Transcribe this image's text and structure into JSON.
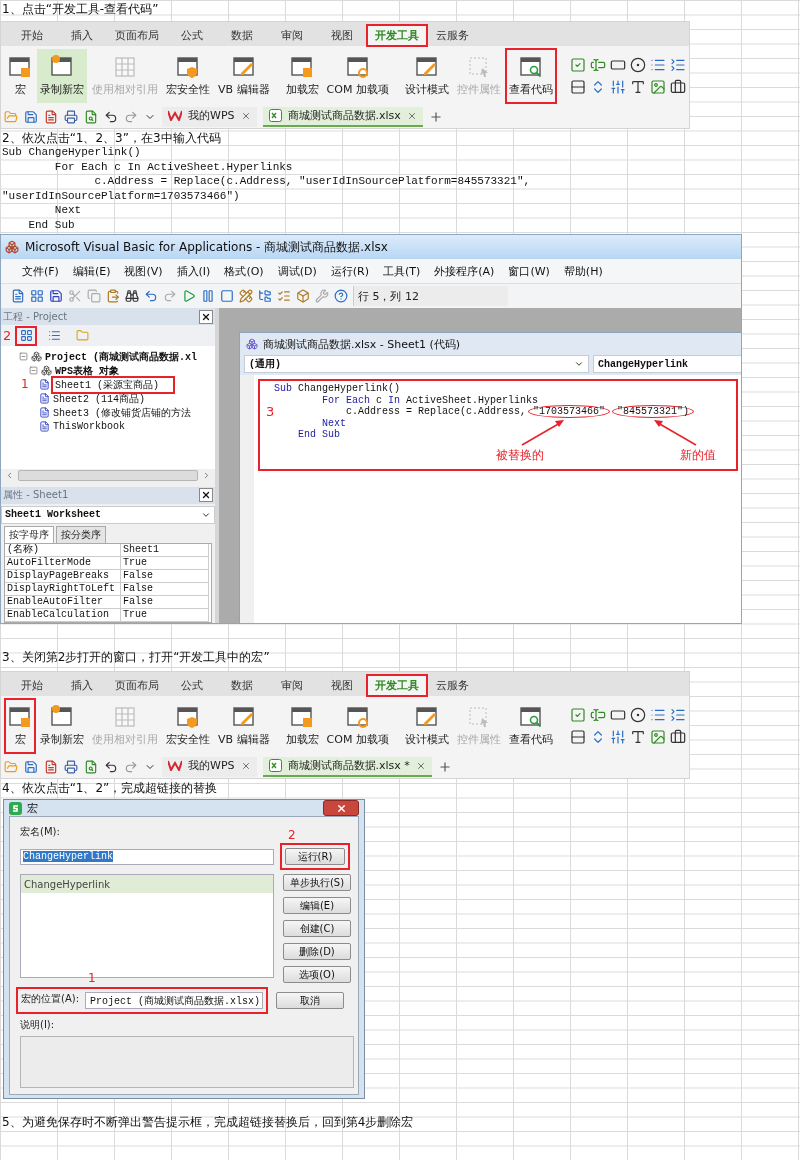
{
  "sections": [
    {
      "kind": "instruction",
      "text": "1、点击“开发工具-查看代码”"
    },
    {
      "kind": "ribbon",
      "tabs": [
        {
          "label": "开始",
          "selected": false,
          "highlighted": false
        },
        {
          "label": "插入",
          "selected": false,
          "highlighted": false
        },
        {
          "label": "页面布局",
          "selected": false,
          "highlighted": false
        },
        {
          "label": "公式",
          "selected": false,
          "highlighted": false
        },
        {
          "label": "数据",
          "selected": false,
          "highlighted": false
        },
        {
          "label": "审阅",
          "selected": false,
          "highlighted": false
        },
        {
          "label": "视图",
          "selected": false,
          "highlighted": false
        },
        {
          "label": "开发工具",
          "selected": true,
          "highlighted": true
        },
        {
          "label": "云服务",
          "selected": false,
          "highlighted": false
        }
      ],
      "tool_groups": [
        [
          {
            "label": "宏",
            "disabled": false,
            "hovered": false,
            "highlighted": false
          },
          {
            "label": "录制新宏",
            "disabled": false,
            "hovered": true,
            "highlighted": false
          },
          {
            "label": "使用相对引用",
            "disabled": true,
            "hovered": false,
            "highlighted": false
          },
          {
            "label": "宏安全性",
            "disabled": false,
            "hovered": false,
            "highlighted": false
          },
          {
            "label": "VB 编辑器",
            "disabled": false,
            "hovered": false,
            "highlighted": false
          }
        ],
        [
          {
            "label": "加载宏",
            "disabled": false,
            "hovered": false,
            "highlighted": false
          },
          {
            "label": "COM 加载项",
            "disabled": false,
            "hovered": false,
            "highlighted": false
          }
        ],
        [
          {
            "label": "设计模式",
            "disabled": false,
            "hovered": false,
            "highlighted": false
          },
          {
            "label": "控件属性",
            "disabled": true,
            "hovered": false,
            "highlighted": false
          },
          {
            "label": "查看代码",
            "disabled": false,
            "hovered": false,
            "highlighted": true
          }
        ]
      ],
      "file_tabs": [
        {
          "label": "我的WPS",
          "selected": false
        },
        {
          "label": "商城测试商品数据.xlsx",
          "selected": true
        }
      ]
    },
    {
      "kind": "instruction",
      "text": "2、依次点击“1、2、3”，在3中输入代码"
    },
    {
      "kind": "code",
      "lines": [
        "Sub ChangeHyperlink()",
        "        For Each c In ActiveSheet.Hyperlinks",
        "              c.Address = Replace(c.Address, \"userIdInSourcePlatform=845573321\",",
        "\"userIdInSourcePlatform=1703573466\")",
        "        Next",
        "    End Sub"
      ]
    },
    {
      "kind": "vba",
      "title": "Microsoft Visual Basic for Applications - 商城测试商品数据.xlsx",
      "menu": [
        "文件(F)",
        "编辑(E)",
        "视图(V)",
        "插入(I)",
        "格式(O)",
        "调试(D)",
        "运行(R)",
        "工具(T)",
        "外接程序(A)",
        "窗口(W)",
        "帮助(H)"
      ],
      "position": "行 5，列 12",
      "project": {
        "title": "工程 - Project",
        "toolbar": [
          {
            "highlighted": true,
            "marker": "2"
          },
          {
            "highlighted": false
          },
          {
            "highlighted": false
          }
        ],
        "tree": [
          {
            "label": "Project (商城测试商品数据.xl",
            "expanded": true,
            "highlighted": false,
            "children": [
              {
                "label": "WPS表格 对象",
                "expanded": true,
                "highlighted": false,
                "children": [
                  {
                    "label": "Sheet1 (采源宝商品)",
                    "highlighted": true,
                    "marker": "1"
                  },
                  {
                    "label": "Sheet2 (114商品)",
                    "highlighted": false
                  },
                  {
                    "label": "Sheet3 (修改铺货店铺的方法",
                    "highlighted": false
                  },
                  {
                    "label": "ThisWorkbook",
                    "highlighted": false
                  }
                ]
              }
            ]
          }
        ]
      },
      "properties": {
        "title": "属性 - Sheet1",
        "object": "Sheet1 Worksheet",
        "tabs": [
          {
            "label": "按字母序",
            "selected": true
          },
          {
            "label": "按分类序",
            "selected": false
          }
        ],
        "rows": [
          [
            "(名称)",
            "Sheet1"
          ],
          [
            "AutoFilterMode",
            "True"
          ],
          [
            "DisplayPageBreaks",
            "False"
          ],
          [
            "DisplayRightToLeft",
            "False"
          ],
          [
            "EnableAutoFilter",
            "False"
          ],
          [
            "EnableCalculation",
            "True"
          ]
        ]
      },
      "code_window": {
        "title": "商城测试商品数据.xlsx - Sheet1 (代码)",
        "object": "(通用)",
        "procedure": "ChangeHyperlink",
        "marker": "3",
        "lines": [
          [
            {
              "text": "Sub",
              "kind": "keyword"
            },
            {
              "text": " ChangeHyperlink()",
              "kind": "plain"
            }
          ],
          [
            {
              "text": "        For Each",
              "kind": "keyword"
            },
            {
              "text": " c ",
              "kind": "plain"
            },
            {
              "text": "In",
              "kind": "keyword"
            },
            {
              "text": " ActiveSheet.Hyperlinks",
              "kind": "plain"
            }
          ],
          [
            {
              "text": "            c.Address = Replace(c.Address,",
              "kind": "plain"
            },
            {
              "text": "\"1703573466\"",
              "kind": "circled"
            },
            {
              "text": "\"845573321\")",
              "kind": "circled"
            }
          ],
          [
            {
              "text": "        Next",
              "kind": "keyword"
            }
          ],
          [
            {
              "text": "    End Sub",
              "kind": "keyword"
            }
          ]
        ],
        "callouts": [
          "被替换的",
          "新的值"
        ]
      }
    },
    {
      "kind": "instruction",
      "text": "3、关闭第2步打开的窗口，打开“开发工具中的宏”"
    },
    {
      "kind": "ribbon",
      "tabs": [
        {
          "label": "开始",
          "selected": false,
          "highlighted": false
        },
        {
          "label": "插入",
          "selected": false,
          "highlighted": false
        },
        {
          "label": "页面布局",
          "selected": false,
          "highlighted": false
        },
        {
          "label": "公式",
          "selected": false,
          "highlighted": false
        },
        {
          "label": "数据",
          "selected": false,
          "highlighted": false
        },
        {
          "label": "审阅",
          "selected": false,
          "highlighted": false
        },
        {
          "label": "视图",
          "selected": false,
          "highlighted": false
        },
        {
          "label": "开发工具",
          "selected": true,
          "highlighted": true
        },
        {
          "label": "云服务",
          "selected": false,
          "highlighted": false
        }
      ],
      "tool_groups": [
        [
          {
            "label": "宏",
            "disabled": false,
            "hovered": false,
            "highlighted": true
          },
          {
            "label": "录制新宏",
            "disabled": false,
            "hovered": false,
            "highlighted": false
          },
          {
            "label": "使用相对引用",
            "disabled": true,
            "hovered": false,
            "highlighted": false
          },
          {
            "label": "宏安全性",
            "disabled": false,
            "hovered": false,
            "highlighted": false
          },
          {
            "label": "VB 编辑器",
            "disabled": false,
            "hovered": false,
            "highlighted": false
          }
        ],
        [
          {
            "label": "加载宏",
            "disabled": false,
            "hovered": false,
            "highlighted": false
          },
          {
            "label": "COM 加载项",
            "disabled": false,
            "hovered": false,
            "highlighted": false
          }
        ],
        [
          {
            "label": "设计模式",
            "disabled": false,
            "hovered": false,
            "highlighted": false
          },
          {
            "label": "控件属性",
            "disabled": true,
            "hovered": false,
            "highlighted": false
          },
          {
            "label": "查看代码",
            "disabled": false,
            "hovered": false,
            "highlighted": false
          }
        ]
      ],
      "file_tabs": [
        {
          "label": "我的WPS",
          "selected": false
        },
        {
          "label": "商城测试商品数据.xlsx *",
          "selected": true
        }
      ]
    },
    {
      "kind": "instruction",
      "text": "4、依次点击“1、2”，完成超链接的替换"
    },
    {
      "kind": "dialog",
      "title": "宏",
      "name_label": "宏名(M):",
      "name_value": "ChangeHyperlink",
      "macros": [
        {
          "label": "ChangeHyperlink",
          "selected": true
        }
      ],
      "buttons": [
        {
          "label": "运行(R)",
          "highlighted": true,
          "marker": "2"
        },
        {
          "label": "单步执行(S)",
          "highlighted": false
        },
        {
          "label": "编辑(E)",
          "highlighted": false
        },
        {
          "label": "创建(C)",
          "highlighted": false
        },
        {
          "label": "删除(D)",
          "highlighted": false
        },
        {
          "label": "选项(O)",
          "highlighted": false
        },
        {
          "label": "取消",
          "highlighted": false
        }
      ],
      "location_label": "宏的位置(A):",
      "location_value": "Project (商城测试商品数据.xlsx)",
      "location_highlighted": true,
      "location_marker": "1",
      "description_label": "说明(I):"
    },
    {
      "kind": "instruction",
      "text": "5、为避免保存时不断弹出警告提示框，完成超链接替换后，回到第4步删除宏"
    }
  ]
}
